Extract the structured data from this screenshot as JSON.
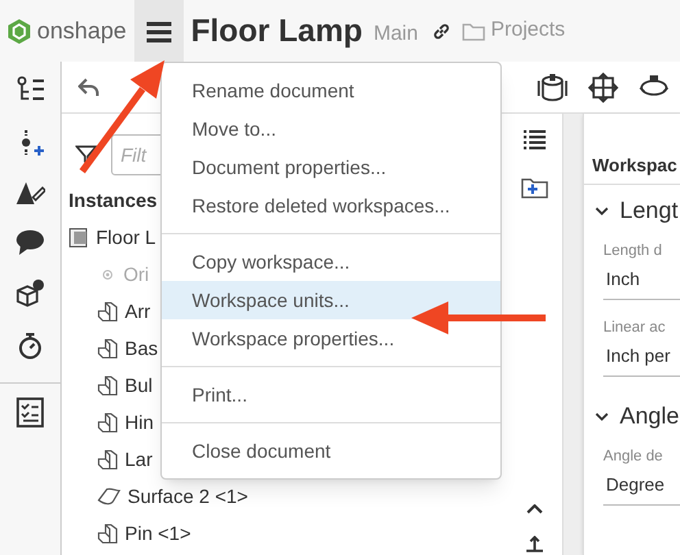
{
  "header": {
    "logo_text": "onshape",
    "title": "Floor Lamp",
    "branch": "Main",
    "folder": "Projects"
  },
  "filter": {
    "placeholder": "Filt"
  },
  "instances": {
    "title": "Instances",
    "tree": [
      {
        "label": "Floor L",
        "kind": "assembly",
        "children": [
          {
            "label": "Ori",
            "kind": "origin"
          },
          {
            "label": "Arr",
            "kind": "part"
          },
          {
            "label": "Bas",
            "kind": "part"
          },
          {
            "label": "Bul",
            "kind": "part"
          },
          {
            "label": "Hin",
            "kind": "part"
          },
          {
            "label": "Lar",
            "kind": "part"
          },
          {
            "label": "Surface 2 <1>",
            "kind": "surface"
          },
          {
            "label": "Pin <1>",
            "kind": "part"
          }
        ]
      }
    ]
  },
  "menu": [
    [
      {
        "label": "Rename document",
        "selected": false
      },
      {
        "label": "Move to...",
        "selected": false
      },
      {
        "label": "Document properties...",
        "selected": false
      },
      {
        "label": "Restore deleted workspaces...",
        "selected": false
      }
    ],
    [
      {
        "label": "Copy workspace...",
        "selected": false
      },
      {
        "label": "Workspace units...",
        "selected": true
      },
      {
        "label": "Workspace properties...",
        "selected": false
      }
    ],
    [
      {
        "label": "Print...",
        "selected": false
      }
    ],
    [
      {
        "label": "Close document",
        "selected": false
      }
    ]
  ],
  "units_panel": {
    "title": "Workspac",
    "sections": [
      {
        "title": "Lengt",
        "expanded": true,
        "fields": [
          {
            "label": "Length d",
            "value": "Inch"
          },
          {
            "label": "Linear ac",
            "value": "Inch per"
          }
        ]
      },
      {
        "title": "Angle",
        "expanded": true,
        "fields": [
          {
            "label": "Angle de",
            "value": "Degree"
          }
        ]
      }
    ]
  }
}
